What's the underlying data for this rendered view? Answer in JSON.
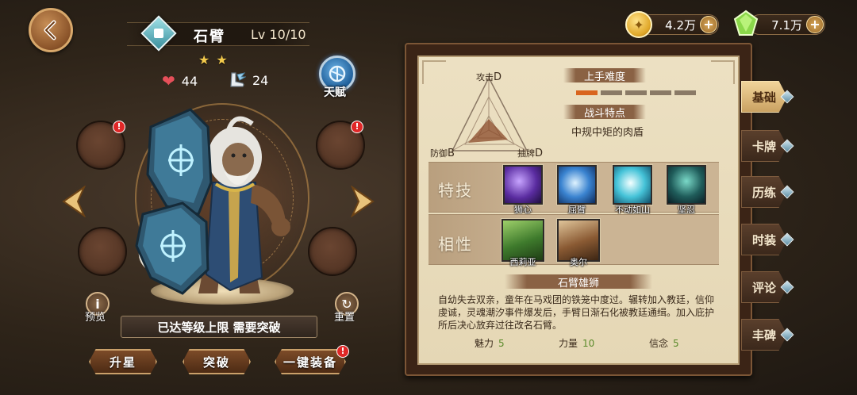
{
  "hero": {
    "name": "石臂",
    "level": "Lv 10/10",
    "stars": "★★",
    "hp": "44",
    "speed": "24",
    "talent_label": "天赋",
    "limit_message": "已达等级上限 需要突破"
  },
  "left_controls": {
    "preview_label": "预览",
    "reset_label": "重置",
    "preview_glyph": "i",
    "reset_glyph": "↻",
    "badge_glyph": "!"
  },
  "actions": {
    "star_up": "升星",
    "breakthrough": "突破",
    "auto_equip": "一键装备"
  },
  "currency": {
    "gold": "4.2万",
    "gems": "7.1万",
    "plus": "+"
  },
  "radar": {
    "attack_label": "攻击",
    "attack_grade": "D",
    "defense_label": "防御",
    "defense_grade": "B",
    "draw_label": "抽牌",
    "draw_grade": "D"
  },
  "difficulty": {
    "title": "上手难度",
    "level": 0.2,
    "segments": 5
  },
  "feature": {
    "title": "战斗特点",
    "text": "中规中矩的肉盾"
  },
  "skills": {
    "label": "特技",
    "items": [
      {
        "name": "狮心",
        "icon": "lionheart-skill-icon"
      },
      {
        "name": "屈臂",
        "icon": "bent-arm-skill-icon"
      },
      {
        "name": "不动如山",
        "icon": "immovable-skill-icon"
      },
      {
        "name": "坚忍",
        "icon": "endurance-skill-icon"
      }
    ]
  },
  "affinity": {
    "label": "相性",
    "items": [
      {
        "name": "西莉亚",
        "icon": "celia-portrait"
      },
      {
        "name": "奥尔",
        "icon": "owl-portrait"
      }
    ]
  },
  "bio": {
    "title": "石臂雄狮",
    "text": "自幼失去双亲，童年在马戏团的铁笼中度过。辗转加入教廷，信仰虔诚，灵魂潮汐事件爆发后，手臂日渐石化被教廷通缉。加入庇护所后决心放弃过往改名石臂。"
  },
  "attributes": [
    {
      "label": "魅力",
      "value": "5"
    },
    {
      "label": "力量",
      "value": "10"
    },
    {
      "label": "信念",
      "value": "5"
    }
  ],
  "tabs": [
    "基础",
    "卡牌",
    "历练",
    "时装",
    "评论",
    "丰碑"
  ],
  "active_tab": 0,
  "colors": {
    "accent_gold": "#caa06a",
    "difficulty_on": "#d9651e",
    "attr_value": "#5a8a2a",
    "badge_red": "#e02727"
  }
}
